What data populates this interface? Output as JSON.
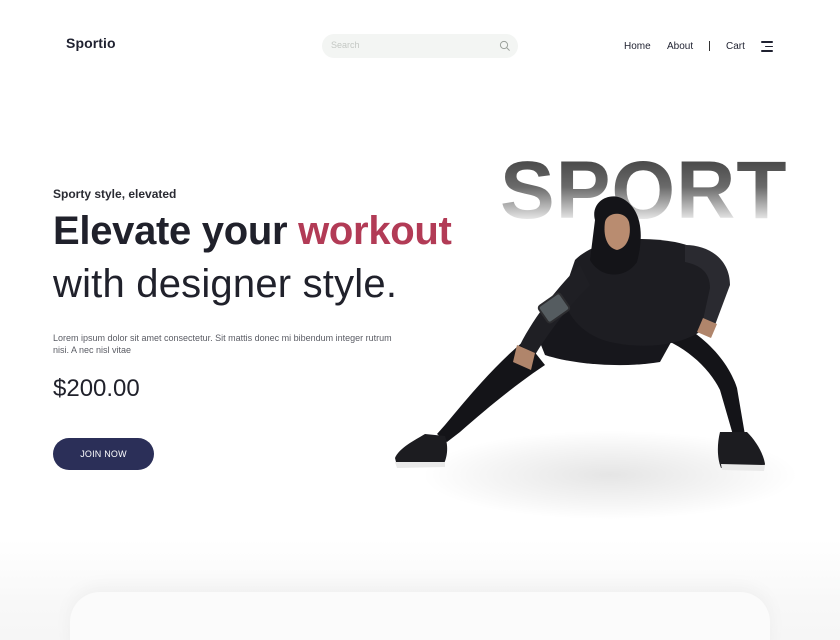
{
  "header": {
    "logo": "Sportio",
    "search_placeholder": "Search",
    "nav": {
      "home": "Home",
      "about": "About",
      "cart": "Cart"
    }
  },
  "hero": {
    "eyebrow": "Sporty style, elevated",
    "headline_line1_prefix": "Elevate your ",
    "headline_line1_accent": "workout",
    "headline_line2": "with designer style.",
    "description": "Lorem ipsum dolor sit amet consectetur. Sit mattis donec mi bibendum integer rutrum nisi. A nec nisl vitae",
    "price": "$200.00",
    "cta_label": "JOIN NOW",
    "big_word": "SPORT"
  },
  "colors": {
    "accent": "#b23b56",
    "button": "#2b2f58",
    "text": "#20212b"
  },
  "icons": {
    "search": "search-icon",
    "menu": "menu-icon"
  }
}
